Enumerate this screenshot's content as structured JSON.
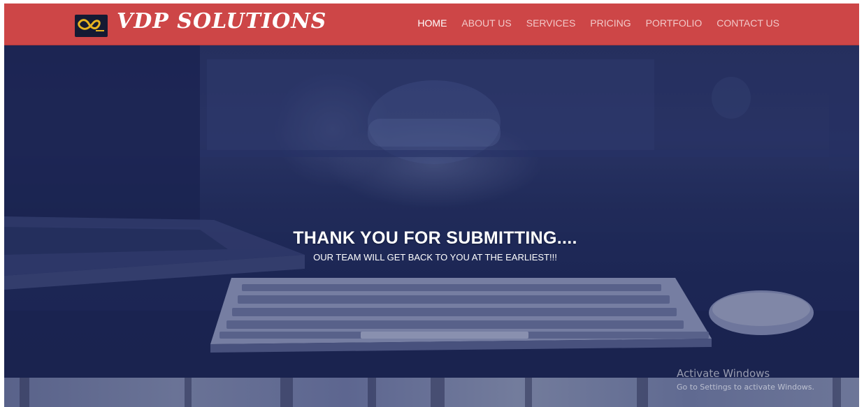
{
  "header": {
    "brand": "VDP SOLUTIONS",
    "logo_icon": "vdp-infinity-logo-icon",
    "nav": [
      {
        "label": "HOME",
        "active": true
      },
      {
        "label": "ABOUT US",
        "active": false
      },
      {
        "label": "SERVICES",
        "active": false
      },
      {
        "label": "PRICING",
        "active": false
      },
      {
        "label": "PORTFOLIO",
        "active": false
      },
      {
        "label": "CONTACT US",
        "active": false
      }
    ]
  },
  "hero": {
    "title": "THANK YOU FOR SUBMITTING....",
    "subtitle": "OUR TEAM WILL GET BACK TO YOU AT THE EARLIEST!!!"
  },
  "watermark": {
    "title": "Activate Windows",
    "subtitle": "Go to Settings to activate Windows."
  },
  "colors": {
    "header_bg": "#cd4647",
    "hero_overlay": "#1e2957",
    "logo_gold": "#e7b320"
  }
}
